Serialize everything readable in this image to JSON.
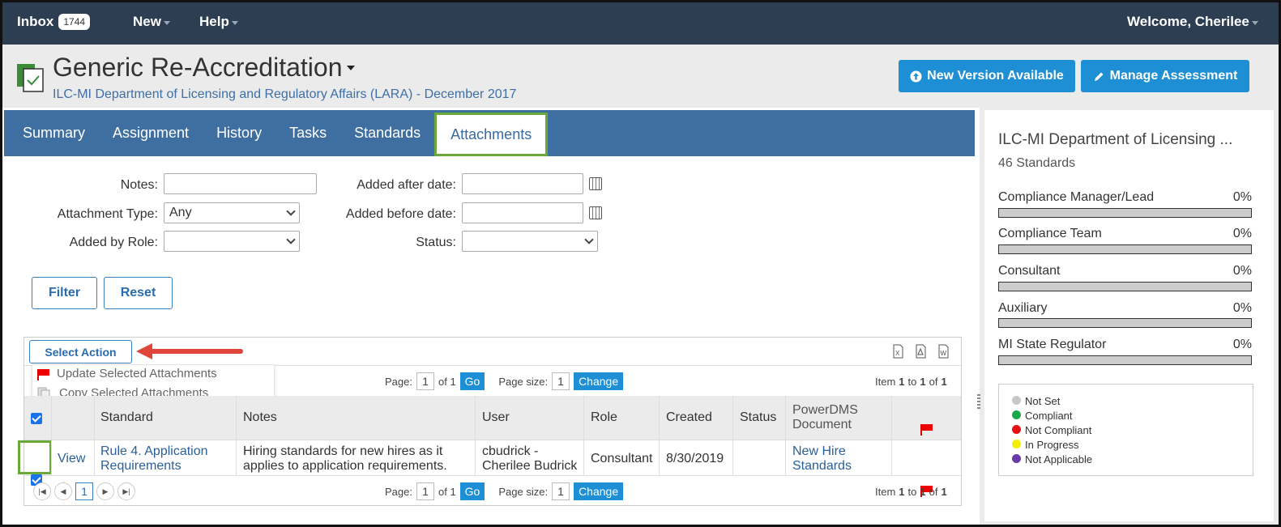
{
  "topbar": {
    "inbox_label": "Inbox",
    "inbox_count": "1744",
    "new_label": "New",
    "help_label": "Help",
    "welcome": "Welcome, Cherilee"
  },
  "header": {
    "title": "Generic Re-Accreditation",
    "subtitle": "ILC-MI Department of Licensing and Regulatory Affairs (LARA) - December 2017",
    "new_version_button": "New Version Available",
    "manage_button": "Manage Assessment"
  },
  "tabs": [
    "Summary",
    "Assignment",
    "History",
    "Tasks",
    "Standards",
    "Attachments"
  ],
  "active_tab": "Attachments",
  "filters": {
    "notes_label": "Notes:",
    "attachment_type_label": "Attachment Type:",
    "attachment_type_value": "Any",
    "added_by_role_label": "Added by Role:",
    "added_after_label": "Added after date:",
    "added_before_label": "Added before date:",
    "status_label": "Status:",
    "filter_button": "Filter",
    "reset_button": "Reset"
  },
  "grid": {
    "select_action": "Select Action",
    "menu_items": [
      "Update Selected Attachments",
      "Copy Selected Attachments"
    ],
    "pager": {
      "page_label": "Page:",
      "page_value": "1",
      "of_label": "of 1",
      "go": "Go",
      "page_size_label": "Page size:",
      "page_size_value": "1",
      "change": "Change",
      "item_label": "Item",
      "item_from": "1",
      "to_label": "to",
      "item_to": "1",
      "of2_label": "of",
      "item_total": "1",
      "current_page": "1"
    },
    "columns": [
      "Standard",
      "Notes",
      "User",
      "Role",
      "Created",
      "Status",
      "PowerDMS Document"
    ],
    "rows": [
      {
        "view": "View",
        "standard": "Rule 4. Application Requirements",
        "notes": "Hiring standards for new hires as it applies to application requirements.",
        "user": "cbudrick - Cherilee Budrick",
        "role": "Consultant",
        "created": "8/30/2019",
        "status": "",
        "document": "New Hire Standards"
      }
    ]
  },
  "side": {
    "title": "ILC-MI Department of Licensing ...",
    "standards_count": "46 Standards",
    "progress": [
      {
        "label": "Compliance Manager/Lead",
        "value": "0%"
      },
      {
        "label": "Compliance Team",
        "value": "0%"
      },
      {
        "label": "Consultant",
        "value": "0%"
      },
      {
        "label": "Auxiliary",
        "value": "0%"
      },
      {
        "label": "MI State Regulator",
        "value": "0%"
      }
    ],
    "legend": [
      {
        "label": "Not Set",
        "color": "#c8c8c8"
      },
      {
        "label": "Compliant",
        "color": "#1aa84a"
      },
      {
        "label": "Not Compliant",
        "color": "#e81010"
      },
      {
        "label": "In Progress",
        "color": "#f2f000"
      },
      {
        "label": "Not Applicable",
        "color": "#6a3aa8"
      }
    ]
  }
}
